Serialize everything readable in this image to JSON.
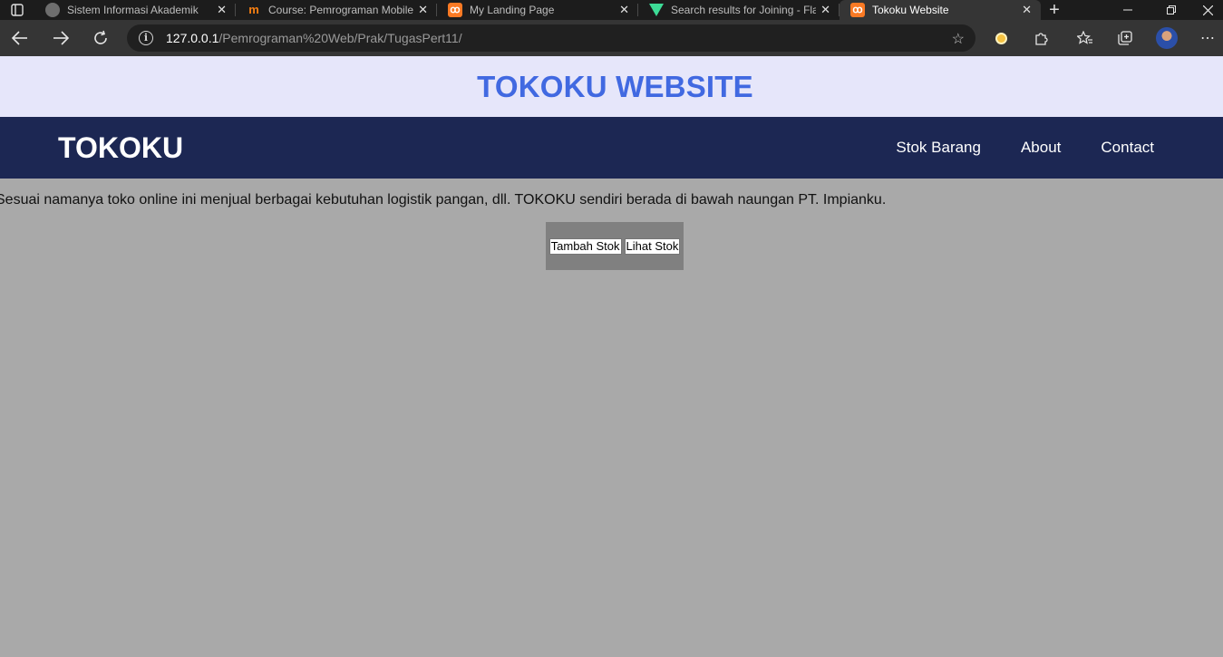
{
  "browser": {
    "tabs": [
      {
        "title": "Sistem Informasi Akademik",
        "icon": "gray-circle-icon",
        "active": false
      },
      {
        "title": "Course: Pemrograman Mobile",
        "icon": "moodle-icon",
        "active": false
      },
      {
        "title": "My Landing Page",
        "icon": "xampp-icon",
        "active": false
      },
      {
        "title": "Search results for Joining - Fla",
        "icon": "green-triangle-icon",
        "active": false
      },
      {
        "title": "Tokoku Website",
        "icon": "xampp-icon",
        "active": true
      }
    ],
    "close_glyph": "✕",
    "url_host": "127.0.0.1",
    "url_path": "/Pemrograman%20Web/Prak/TugasPert11/"
  },
  "page": {
    "header_title": "TOKOKU WEBSITE",
    "brand": "TOKOKU",
    "nav": [
      "Stok Barang",
      "About",
      "Contact"
    ],
    "intro": "Sesuai namanya toko online ini menjual berbagai kebutuhan logistik pangan, dll. TOKOKU sendiri berada di bawah naungan PT. Impianku.",
    "buttons": {
      "tambah": "Tambah Stok",
      "lihat": "Lihat Stok"
    }
  },
  "colors": {
    "page_bg": "#a9a9a9",
    "header_bg": "#e6e6fa",
    "header_text": "#4169e1",
    "nav_bg": "#1c2753",
    "action_box_bg": "#808080"
  }
}
